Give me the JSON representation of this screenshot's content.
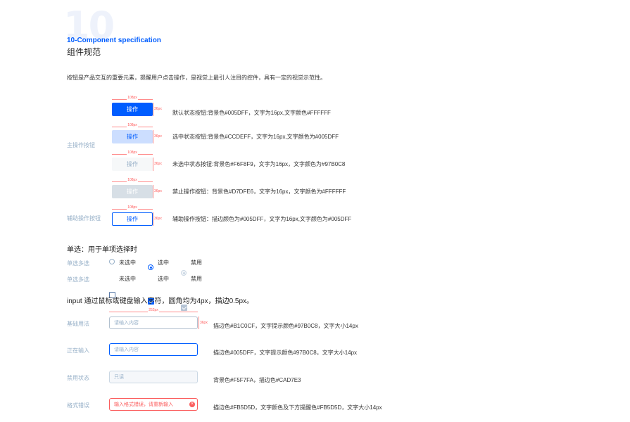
{
  "header": {
    "big_number": "10",
    "english_title": "10-Component specification",
    "chinese_title": "组件规范",
    "intro": "按钮是产品交互的重要元素，提醒用户点击操作，是视觉上最引人注目的控件，具有一定的视觉示范性。"
  },
  "buttons_section": {
    "primary_label": "主操作按钮",
    "secondary_label": "辅助操作按钮",
    "width_dim": "108px",
    "height_dim": "36px",
    "rows": [
      {
        "label": "操作",
        "bg": "#005DFF",
        "color": "#FFFFFF",
        "desc": "默认状态按钮:背景色#005DFF，文字为16px,文字颜色#FFFFFF"
      },
      {
        "label": "操作",
        "bg": "#CCDEFF",
        "color": "#005DFF",
        "desc": "选中状态按钮:背景色#CCDEFF，文字为16px,文字颜色为#005DFF"
      },
      {
        "label": "操作",
        "bg": "#F6F8F9",
        "color": "#97B0C8",
        "desc": "未选中状态按钮:背景色#F6F8F9，文字为16px，文字颜色为#97B0C8"
      },
      {
        "label": "操作",
        "bg": "#D7DFE6",
        "color": "#FFFFFF",
        "desc": "禁止操作按钮：背景色#D7DFE6，文字为16px，文字颜色为#FFFFFF"
      },
      {
        "label": "操作",
        "bg": "#FFFFFF",
        "color": "#005DFF",
        "border": "#005DFF",
        "desc": "辅助操作按钮：描边颜色为#005DFF，文字为16px,文字颜色为#005DFF"
      }
    ]
  },
  "selection_section": {
    "title": "单选：用于单项选择时",
    "row1_label": "单选多选",
    "row2_label": "单选多选",
    "options": [
      "未选中",
      "选中",
      "禁用"
    ]
  },
  "input_section": {
    "title": "input 通过鼠标或键盘输入字符，圆角均为4px，描边0.5px。",
    "width_dim": "252px",
    "height_dim": "36px",
    "rows": [
      {
        "label": "基础用法",
        "placeholder": "请输入内容",
        "desc": "描边色#B1C0CF，文字提示颜色#97B0C8，文字大小14px"
      },
      {
        "label": "正在输入",
        "placeholder": "请输入内容",
        "desc": "描边色#005DFF，文字提示颜色#97B0C8，文字大小14px"
      },
      {
        "label": "禁用状态",
        "placeholder": "只读",
        "desc": "背景色#F5F7FA，描边色#CAD7E3"
      },
      {
        "label": "格式错误",
        "placeholder": "输入格式错误，请重新输入",
        "desc": "描边色#FB5D5D，文字颜色及下方提醒色#FB5D5D，文字大小14px"
      }
    ]
  },
  "icons": {
    "error_clear": "close-circle-icon",
    "checkmark": "check-icon"
  }
}
